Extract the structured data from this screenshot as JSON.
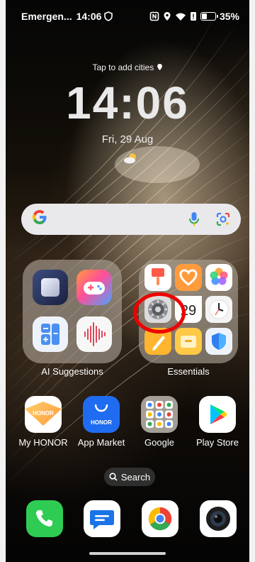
{
  "status_bar": {
    "carrier": "Emergen...",
    "time": "14:06",
    "battery": "35%"
  },
  "lock_widget": {
    "tap_cities": "Tap to add cities",
    "clock": "14:06",
    "date": "Fri, 29 Aug"
  },
  "search_bar": {
    "logo": "G"
  },
  "folders": {
    "left_label": "AI Suggestions",
    "right_label": "Essentials",
    "calendar_day": "29"
  },
  "apps": [
    {
      "label": "My HONOR"
    },
    {
      "label": "App Market"
    },
    {
      "label": "Google"
    },
    {
      "label": "Play Store"
    }
  ],
  "honor_text": "HONOR",
  "search_pill": {
    "label": "Search"
  },
  "colors": {
    "highlight": "#e00000",
    "phone_green": "#2ecc52",
    "messages_blue": "#1a73e8"
  }
}
